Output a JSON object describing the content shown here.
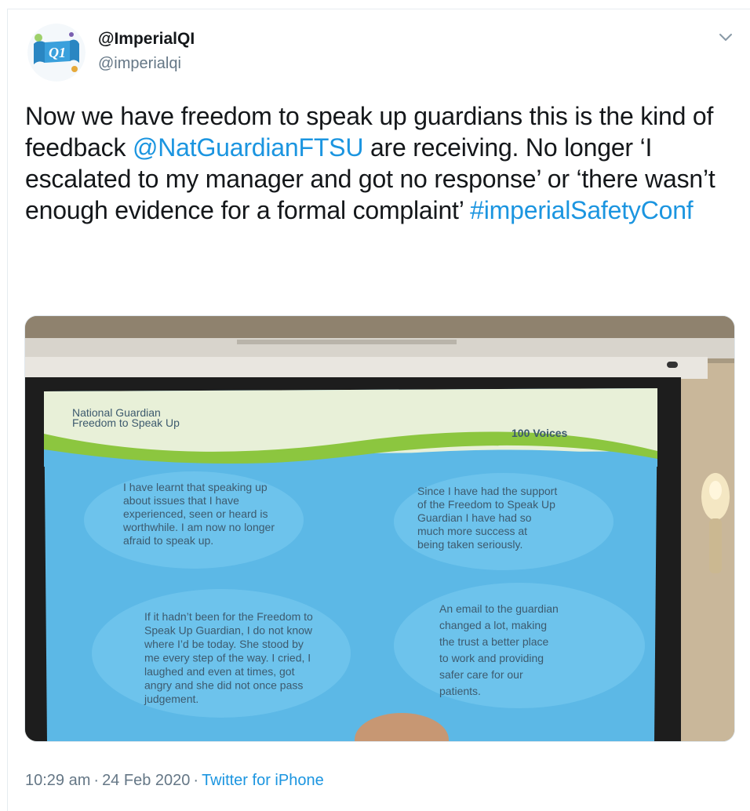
{
  "tweet": {
    "display_name": "@ImperialQI",
    "handle": "@imperialqi",
    "avatar_label": "Q1",
    "text_parts": {
      "p1": "Now we have freedom to speak up guardians this is the kind of feedback ",
      "mention": "@NatGuardianFTSU",
      "p2": " are receiving. No longer ‘I escalated to my manager and got no response’ or ‘there wasn’t enough evidence for a formal complaint’ ",
      "hashtag": "#imperialSafetyConf"
    },
    "time": "10:29 am",
    "separator": "·",
    "date": "24 Feb 2020",
    "source": "Twitter for iPhone"
  },
  "photo": {
    "slide_brand_line1": "National Guardian",
    "slide_brand_line2": "Freedom to Speak Up",
    "slide_title": "100 Voices",
    "quote1": [
      "I have learnt that speaking up",
      "about issues that I have",
      "experienced, seen or heard is",
      "worthwhile. I am now no longer",
      "afraid to speak up."
    ],
    "quote2": [
      "Since I have had the support",
      "of the Freedom to Speak Up",
      "Guardian I have had so",
      "much more success at",
      "being taken seriously."
    ],
    "quote3": [
      "If it hadn’t been for the Freedom to",
      "Speak Up Guardian, I do not know",
      "where I’d be today. She stood by",
      "me every step of the way. I cried, I",
      "laughed and even at times, got",
      "angry and she did not once pass",
      "judgement."
    ],
    "quote4": [
      "An email to the guardian",
      "changed a lot, making",
      "the trust a better place",
      "to work and providing",
      "safer care for our",
      "patients."
    ]
  },
  "colors": {
    "link": "#1b95e0",
    "text": "#14171a",
    "secondary": "#657786",
    "slide_bg": "#5cb8e6",
    "slide_green": "#8cc63f"
  },
  "icons": {
    "chevron": "chevron-down-icon",
    "avatar": "imperial-qi-logo"
  }
}
